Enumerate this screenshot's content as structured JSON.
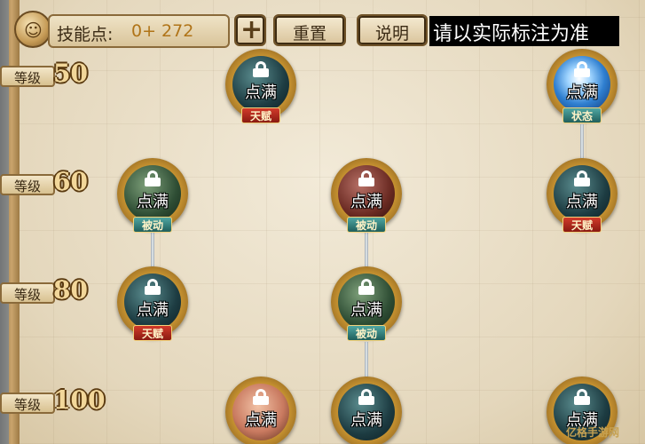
{
  "header": {
    "skill_points_label": "技能点:",
    "skill_points_value": "0+ 272",
    "plus_label": "+",
    "reset_label": "重置",
    "help_label": "说明",
    "notice": "请以实际标注为准"
  },
  "levels": [
    {
      "tag": "等级",
      "value": "50"
    },
    {
      "tag": "等级",
      "value": "60"
    },
    {
      "tag": "等级",
      "value": "80"
    },
    {
      "tag": "等级",
      "value": "100"
    }
  ],
  "nodes": [
    {
      "label": "点满",
      "badge": "天赋"
    },
    {
      "label": "点满",
      "badge": "状态"
    },
    {
      "label": "点满",
      "badge": "被动"
    },
    {
      "label": "点满",
      "badge": "被动"
    },
    {
      "label": "点满",
      "badge": "天赋"
    },
    {
      "label": "点满",
      "badge": "天赋"
    },
    {
      "label": "点满",
      "badge": "被动"
    },
    {
      "label": "点满",
      "badge": ""
    },
    {
      "label": "点满",
      "badge": ""
    },
    {
      "label": "点满",
      "badge": ""
    }
  ],
  "watermark": "亿格手游网",
  "colors": {
    "accent_gold": "#c99431",
    "badge_red": "#d23a2a",
    "badge_teal": "#4fa7a3"
  }
}
